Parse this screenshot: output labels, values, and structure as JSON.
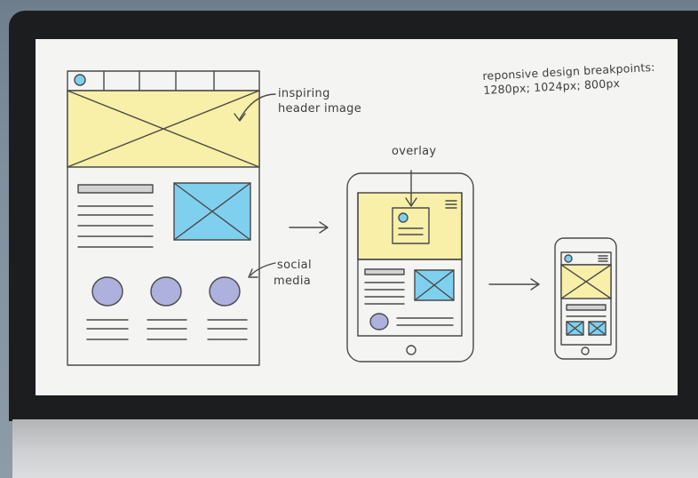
{
  "screen": {
    "headline_line1": "reponsive design breakpoints:",
    "headline_line2": "1280px; 1024px; 800px",
    "labels": {
      "header_image_line1": "inspiring",
      "header_image_line2": "header image",
      "overlay": "overlay",
      "social_line1": "social",
      "social_line2": "media"
    }
  },
  "colors": {
    "yellow": "#f8efa8",
    "blue": "#7fd0ee",
    "purple": "#aeb0dd",
    "line": "#4a4a4a",
    "gray_bar": "#d2d2d2"
  },
  "icons": {
    "arrows": [
      "arrow-right-icon",
      "arrow-right-icon"
    ],
    "image_placeholder": "image-placeholder-icon",
    "hamburger": "hamburger-menu-icon"
  }
}
